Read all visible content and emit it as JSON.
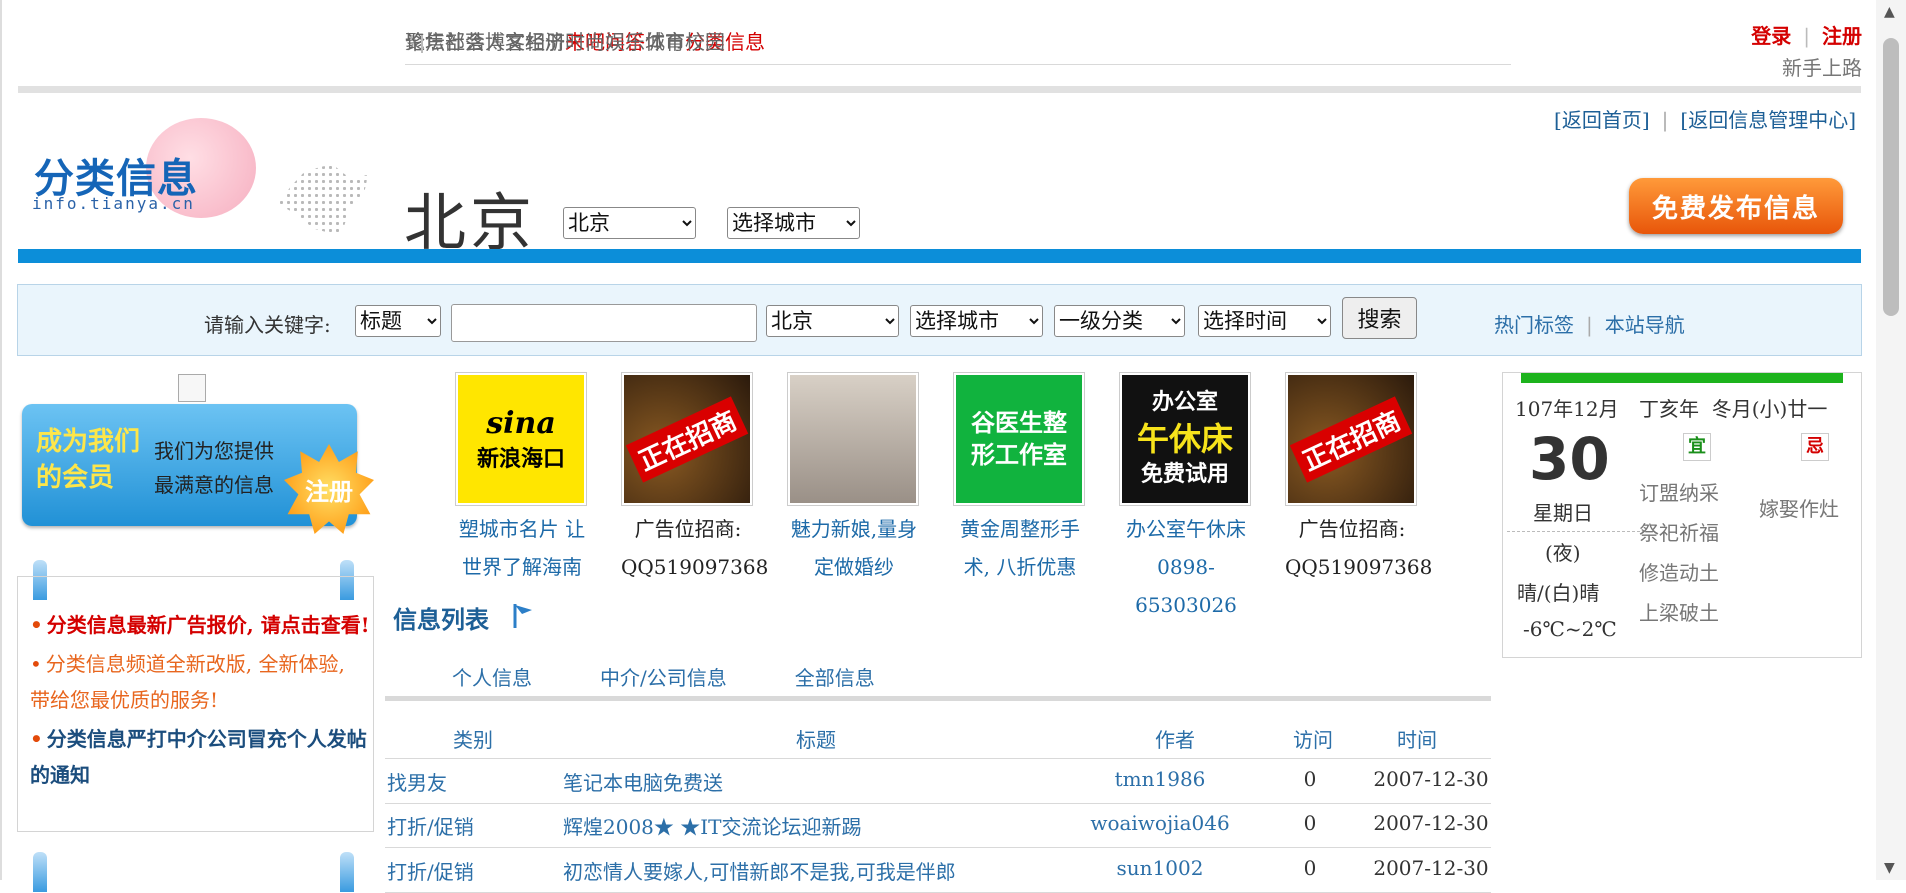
{
  "topnav": {
    "row1": [
      {
        "label": "论坛",
        "red": false
      },
      {
        "label": "部落",
        "red": false
      },
      {
        "label": "博客",
        "red": false
      },
      {
        "label": "相册",
        "red": false
      },
      {
        "label": "来吧",
        "red": true
      },
      {
        "label": "问答",
        "red": true
      },
      {
        "label": "城市",
        "red": false
      },
      {
        "label": "分类信息",
        "red": true
      }
    ],
    "row2": [
      "聚焦",
      "社会",
      "人文",
      "经济",
      "时尚",
      "娱乐",
      "体育",
      "校园"
    ],
    "login": "登录",
    "register": "注册",
    "newbie": "新手上路"
  },
  "header": {
    "back_home": "[返回首页]",
    "back_manage": "[返回信息管理中心]",
    "logo_text": "分类信息",
    "logo_url": "info.tianya.cn",
    "city": "北京",
    "city_select": "北京",
    "city_select2": "选择城市",
    "publish_button": "免费发布信息"
  },
  "search": {
    "label": "请输入关键字:",
    "field_select": "标题",
    "keyword_value": "",
    "city": "北京",
    "city2": "选择城市",
    "category": "一级分类",
    "time": "选择时间",
    "button": "搜索",
    "hot_tags": "热门标签",
    "site_nav": "本站导航"
  },
  "member_banner": {
    "line1": "成为我们",
    "line2": "的会员",
    "desc1": "我们为您提供",
    "desc2": "最满意的信息",
    "register": "注册"
  },
  "notices": [
    "分类信息最新广告报价, 请点击查看!",
    "分类信息频道全新改版, 全新体验, 带给您最优质的服务!",
    "分类信息严打中介公司冒充个人发帖的通知"
  ],
  "ads": [
    {
      "img": "新浪海口",
      "img_top": "sina",
      "caption": "塑城市名片 让世界了解海南",
      "link": true
    },
    {
      "img": "正在招商",
      "caption": "广告位招商: QQ519097368",
      "link": false
    },
    {
      "img": "",
      "caption": "魅力新娘,量身定做婚纱",
      "link": true
    },
    {
      "img": "谷医生整形工作室",
      "caption": "黄金周整形手术, 八折优惠",
      "link": true
    },
    {
      "img_top": "办公室",
      "img": "午休床",
      "img_bottom": "免费试用",
      "caption": "办公室午休床 0898-65303026",
      "link": true
    },
    {
      "img": "正在招商",
      "caption": "广告位招商: QQ519097368",
      "link": false
    }
  ],
  "list": {
    "title": "信息列表",
    "tabs": [
      "个人信息",
      "中介/公司信息",
      "全部信息"
    ],
    "headers": {
      "category": "类别",
      "title": "标题",
      "author": "作者",
      "visits": "访问",
      "time": "时间"
    },
    "rows": [
      {
        "category": "找男友",
        "title": "笔记本电脑免费送",
        "author": "tmn1986",
        "visits": "0",
        "time": "2007-12-30"
      },
      {
        "category": "打折/促销",
        "title": "辉煌2008★ ★IT交流论坛迎新踢",
        "author": "woaiwojia046",
        "visits": "0",
        "time": "2007-12-30"
      },
      {
        "category": "打折/促销",
        "title": "初恋情人要嫁人,可惜新郎不是我,可我是伴郎",
        "author": "sun1002",
        "visits": "0",
        "time": "2007-12-30"
      }
    ]
  },
  "calendar": {
    "date": "107年12月",
    "day": "30",
    "weekday": "星期日",
    "night": "(夜)",
    "weather": "晴/(白)晴",
    "temp": "-6℃~2℃",
    "lunar": "丁亥年  冬月(小)廿一",
    "yi": "宜",
    "ji": "忌",
    "yi_items": [
      "订盟纳采",
      "祭祀祈福",
      "修造动土",
      "上梁破土"
    ],
    "ji_items": "嫁娶作灶"
  },
  "colors": {
    "brand_blue": "#0c8ed9",
    "red": "#d40000",
    "link": "#2c6fa8",
    "green": "#1db31d"
  }
}
